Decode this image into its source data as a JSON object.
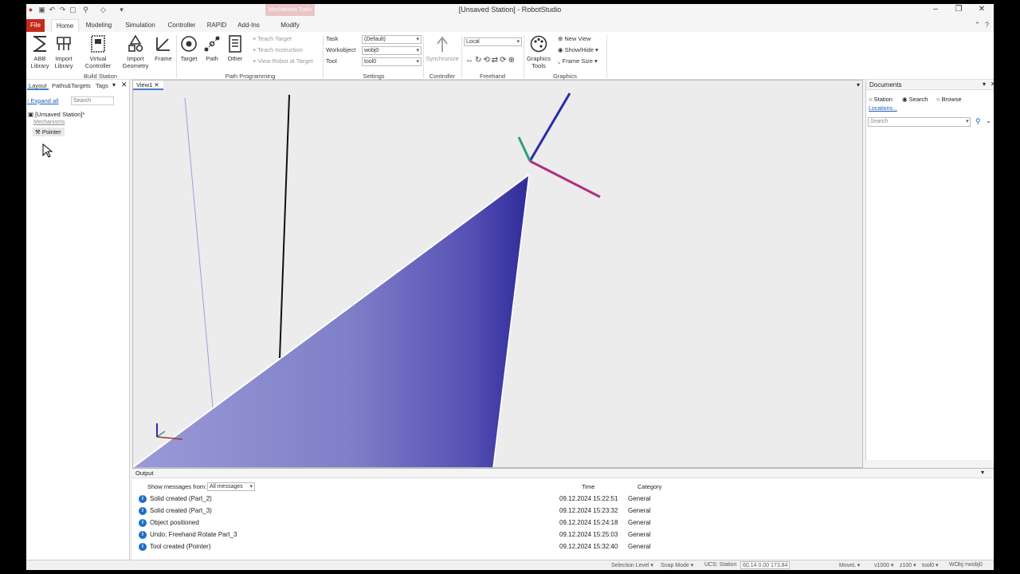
{
  "window": {
    "title": "[Unsaved Station] - RobotStudio",
    "context_tab_group": "Mechanism Tools",
    "controls": [
      "–",
      "❐",
      "✕"
    ]
  },
  "tabs": [
    {
      "label": "File"
    },
    {
      "label": "Home"
    },
    {
      "label": "Modeling"
    },
    {
      "label": "Simulation"
    },
    {
      "label": "Controller"
    },
    {
      "label": "RAPID"
    },
    {
      "label": "Add-Ins"
    },
    {
      "label": "Modify"
    }
  ],
  "ribbon": {
    "build_station": {
      "label": "Build Station",
      "abb_library": [
        "ABB",
        "Library"
      ],
      "import_library": [
        "Import",
        "Library"
      ],
      "virtual_controller": [
        "Virtual",
        "Controller"
      ],
      "import_geometry": [
        "Import",
        "Geometry"
      ],
      "frame": "Frame"
    },
    "path_programming": {
      "label": "Path Programming",
      "target": "Target",
      "path": "Path",
      "other": "Other",
      "teach_target": "Teach Target",
      "teach_instruction": "Teach Instruction",
      "view_robot_at_target": "View Robot at Target"
    },
    "settings": {
      "label": "Settings",
      "task_label": "Task",
      "task_value": "(Default)",
      "workobject_label": "Workobject",
      "workobject_value": "wobj0",
      "tool_label": "Tool",
      "tool_value": "tool0"
    },
    "controller": {
      "label": "Controller",
      "synchronize": "Synchronize"
    },
    "freehand": {
      "label": "Freehand",
      "reference_value": "Local"
    },
    "graphics": {
      "label": "Graphics",
      "graphics_tools": [
        "Graphics",
        "Tools"
      ],
      "new_view": "New View",
      "show_hide": "Show/Hide",
      "frame_size": "Frame Size"
    }
  },
  "left_panel": {
    "tabs": [
      "Layout",
      "Paths&Targets",
      "Tags"
    ],
    "expand_all": "Expand all",
    "search_placeholder": "Search",
    "tree": {
      "station": "[Unsaved Station]*",
      "group": "Mechanisms",
      "item": "Pointer"
    }
  },
  "viewport": {
    "tab": "View1"
  },
  "documents": {
    "title": "Documents",
    "options": [
      "Station",
      "Search",
      "Browse"
    ],
    "selected_option": "Search",
    "locations": "Locations...",
    "search_placeholder": "Search"
  },
  "output": {
    "title": "Output",
    "show_messages_label": "Show messages from:",
    "filter_value": "All messages",
    "columns": {
      "time": "Time",
      "category": "Category"
    },
    "rows": [
      {
        "message": "Solid created (Part_2)",
        "time": "09.12.2024 15:22:51",
        "category": "General"
      },
      {
        "message": "Solid created (Part_3)",
        "time": "09.12.2024 15:23:32",
        "category": "General"
      },
      {
        "message": "Object positioned",
        "time": "09.12.2024 15:24:18",
        "category": "General"
      },
      {
        "message": "Undo: Freehand Rotate Part_3",
        "time": "09.12.2024 15:25:03",
        "category": "General"
      },
      {
        "message": "Tool created (Pointer)",
        "time": "09.12.2024 15:32:40",
        "category": "General"
      }
    ]
  },
  "status_bar": {
    "selection_level": "Selection Level",
    "snap_mode": "Snap Mode",
    "ucs": "UCS: Station",
    "coords": "60.14  0.00  173.84",
    "move": "MoveL",
    "speed": "v1000",
    "zone": "z100",
    "tool": "tool0",
    "wobj": "WObj:=wobj0"
  },
  "colors": {
    "accent": "#4a7dc4",
    "file_tab": "#c42b1c",
    "cone_dark": "#3a35a0",
    "cone_light": "#8c8cd0",
    "axis_x": "#b03080",
    "axis_y": "#2aa080",
    "axis_z": "#2a2ab0"
  }
}
